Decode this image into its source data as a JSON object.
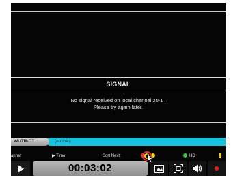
{
  "signal": {
    "title": "SIGNAL",
    "message_line1": "No signal received on local channel 20-1 .",
    "message_line2": "Please try again later."
  },
  "channel_bar": {
    "channel_name": "WUTR-DT",
    "program_info": "(no info)"
  },
  "legend": {
    "channel_label": "annel",
    "time_label": "▶ Time",
    "sort_next_label": "Sort Next:",
    "hd_label": "HD",
    "colors": {
      "red": "#e23a3a",
      "green": "#3fc24a",
      "yellow": "#f0d000"
    }
  },
  "player": {
    "play_icon": "play-icon",
    "elapsed_time": "00:03:02",
    "controls": [
      "picture-icon",
      "fullscreen-icon",
      "volume-icon",
      "record-icon"
    ]
  },
  "colors": {
    "info_bar": "#16c2dd",
    "record": "#e02020"
  }
}
